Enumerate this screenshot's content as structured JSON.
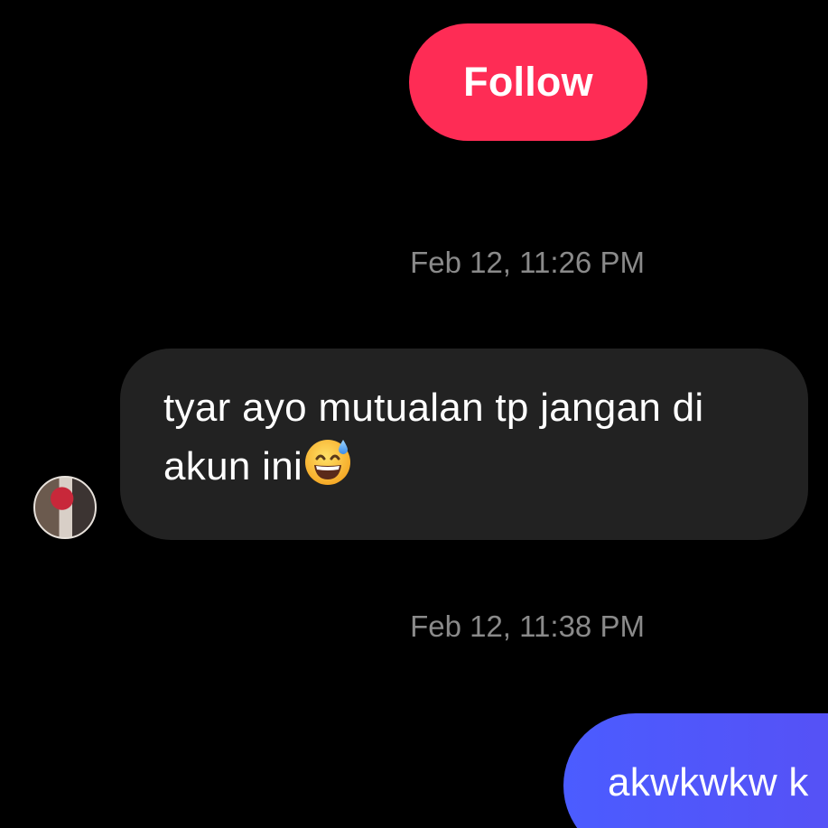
{
  "follow_button": {
    "label": "Follow",
    "color": "#fe2c55"
  },
  "messages": [
    {
      "type": "timestamp",
      "text": "Feb 12, 11:26 PM"
    },
    {
      "type": "incoming",
      "text": "tyar ayo mutualan tp jangan di akun ini",
      "emoji": "😅",
      "emoji_name": "grinning-face-with-sweat-icon"
    },
    {
      "type": "timestamp",
      "text": "Feb 12, 11:38 PM"
    },
    {
      "type": "outgoing",
      "text": "akwkwkw k"
    }
  ],
  "colors": {
    "background": "#000000",
    "incoming_bubble": "#222222",
    "outgoing_bubble": "#4b5cff",
    "timestamp": "#8a8a8a"
  }
}
